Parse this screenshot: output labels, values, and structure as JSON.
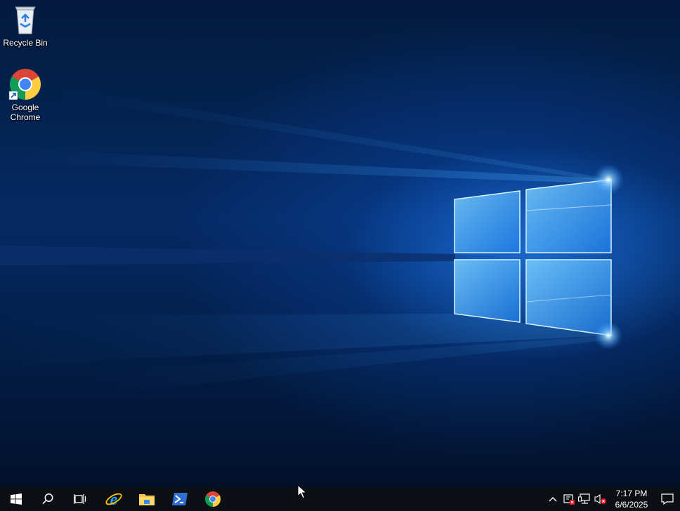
{
  "desktop": {
    "icons": [
      {
        "label": "Recycle Bin",
        "icon": "recycle-bin-icon"
      },
      {
        "label": "Google\nChrome",
        "icon": "chrome-icon"
      }
    ]
  },
  "taskbar": {
    "pinned": [
      {
        "name": "start",
        "icon": "windows-logo-icon"
      },
      {
        "name": "search",
        "icon": "search-icon"
      },
      {
        "name": "task-view",
        "icon": "task-view-icon"
      },
      {
        "name": "internet-explorer",
        "icon": "internet-explorer-icon"
      },
      {
        "name": "file-explorer",
        "icon": "folder-icon"
      },
      {
        "name": "powershell",
        "icon": "powershell-icon"
      },
      {
        "name": "chrome",
        "icon": "chrome-icon"
      }
    ],
    "tray": {
      "icons": [
        "chevron-up-icon",
        "security-warning-icon",
        "network-icon",
        "volume-muted-icon"
      ],
      "time": "7:17 PM",
      "date": "6/6/2025"
    }
  },
  "colors": {
    "taskbar": "#0c0f14",
    "wallpaper_glow": "#3fa9ff"
  }
}
